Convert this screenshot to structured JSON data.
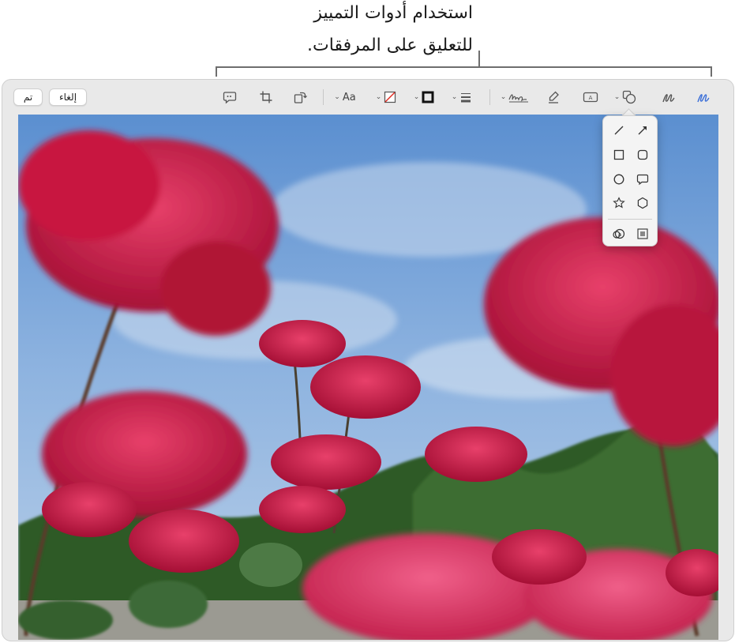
{
  "callout": {
    "line1": "استخدام أدوات التمييز",
    "line2": "للتعليق على المرفقات."
  },
  "toolbar": {
    "done_label": "تم",
    "cancel_label": "إلغاء",
    "text_style_label": "Aa",
    "accent_color": "#3b6fd8"
  },
  "shapes_popover": {
    "items": [
      "line-icon",
      "arrow-icon",
      "square-icon",
      "rounded-square-icon",
      "circle-icon",
      "speech-bubble-icon",
      "star-icon",
      "hexagon-icon",
      "magnifier-icon",
      "highlight-icon"
    ]
  }
}
